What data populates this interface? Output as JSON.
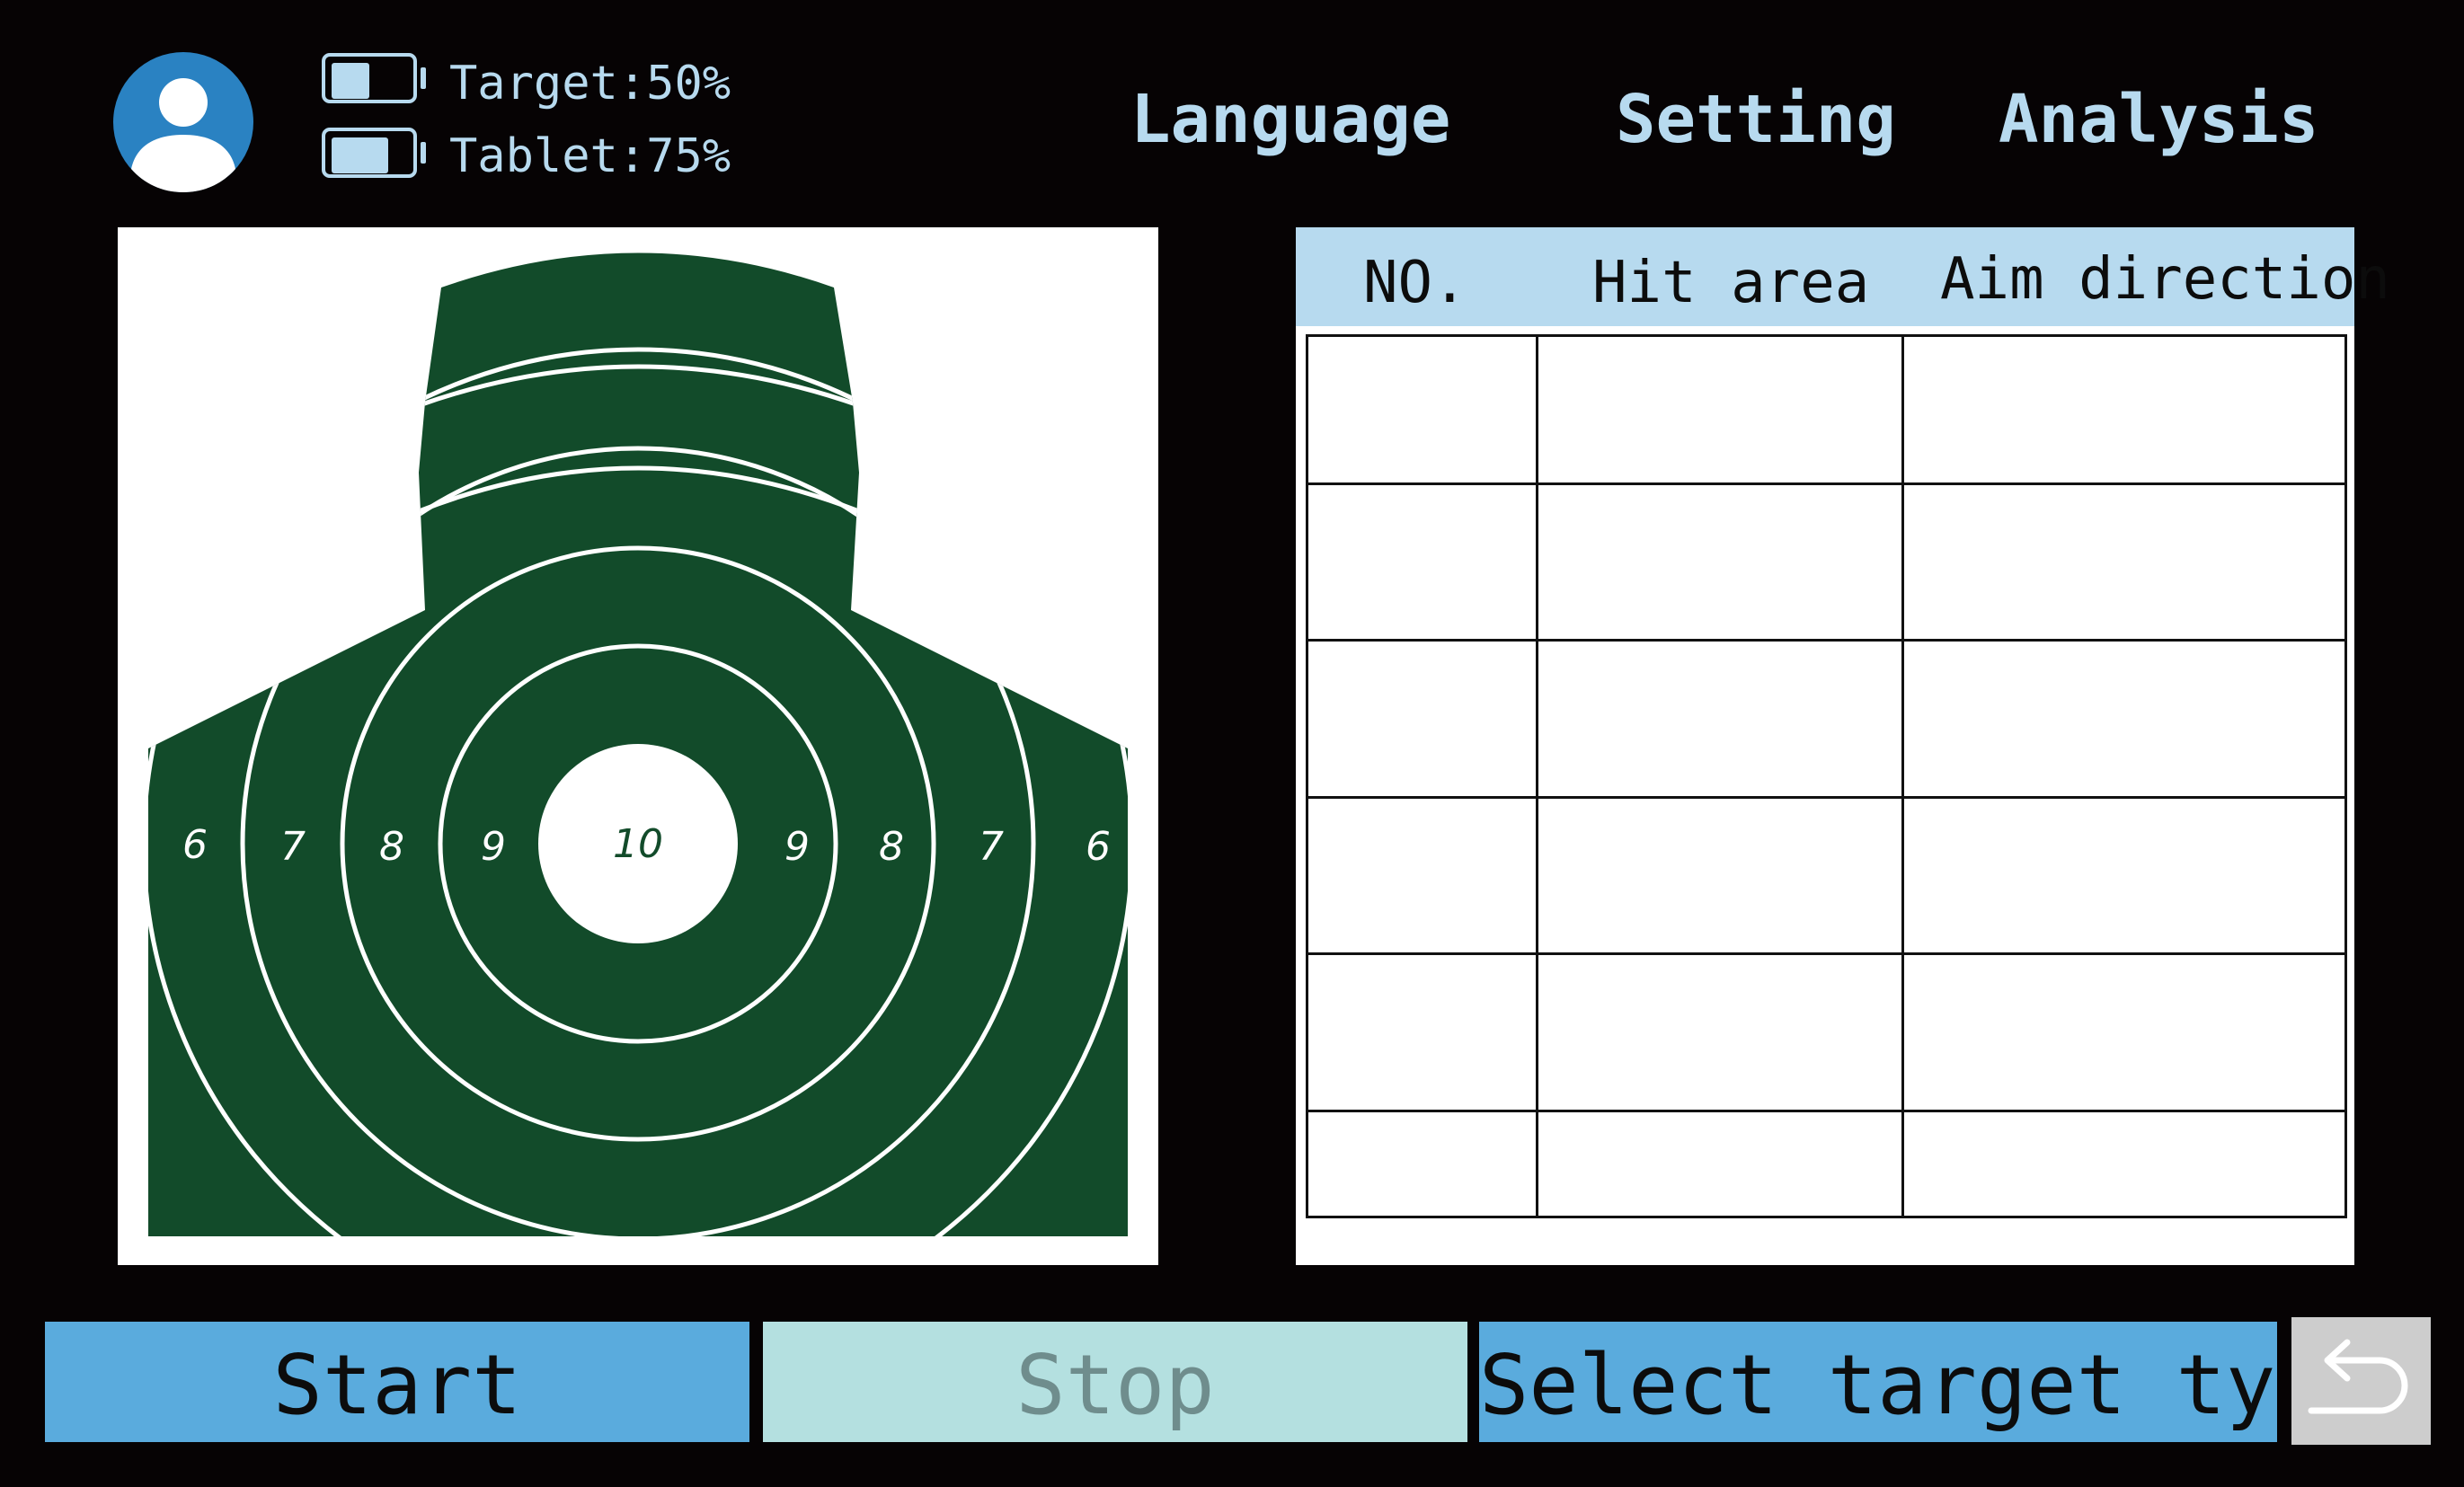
{
  "header": {
    "target_battery_label": "Target:50%",
    "target_battery_level": 0.5,
    "tablet_battery_label": "Tablet:75%",
    "tablet_battery_level": 0.75,
    "menu": {
      "language": "Language",
      "setting": "Setting",
      "analysis": "Analysis"
    },
    "avatar_icon": "user-avatar-icon"
  },
  "target": {
    "type": "silhouette-bullseye",
    "color": "#124b2a",
    "ring_scores": {
      "center": "10",
      "left": [
        "6",
        "7",
        "8",
        "9"
      ],
      "right": [
        "9",
        "8",
        "7",
        "6"
      ]
    }
  },
  "results_table": {
    "columns": [
      "NO.",
      "Hit area",
      "Aim direction"
    ],
    "rows": [
      [
        "",
        "",
        ""
      ],
      [
        "",
        "",
        ""
      ],
      [
        "",
        "",
        ""
      ],
      [
        "",
        "",
        ""
      ],
      [
        "",
        "",
        ""
      ],
      [
        "",
        "",
        ""
      ]
    ]
  },
  "controls": {
    "start_label": "Start",
    "stop_label": "Stop",
    "select_target_label": "Select target type",
    "back_icon": "return-arrow-icon"
  },
  "colors": {
    "background": "#060304",
    "accent_light": "#b7daef",
    "button_blue": "#5aabdd",
    "button_disabled": "#b4e0e0",
    "target_green": "#124b2a"
  }
}
